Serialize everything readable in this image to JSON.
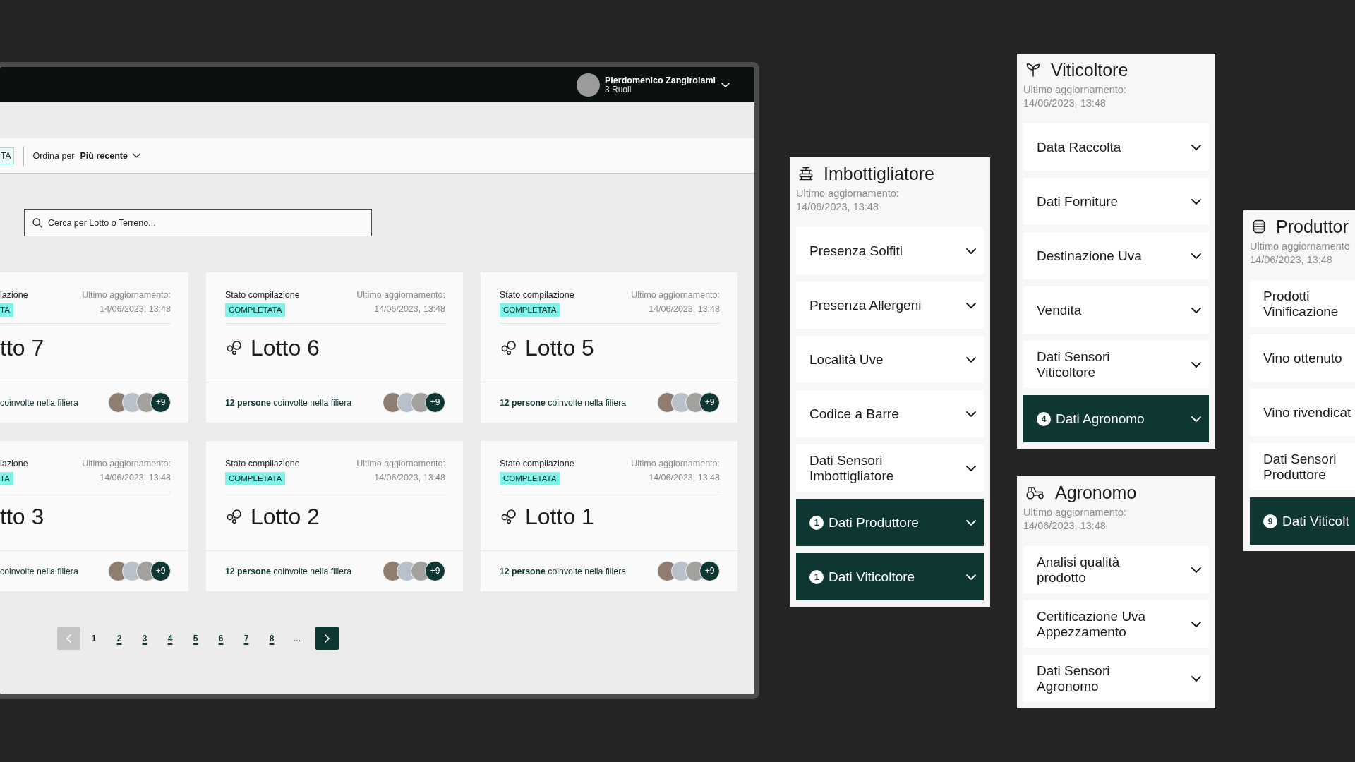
{
  "app_window": {
    "header": {
      "user_name": "Pierdomenico Zangirolami",
      "user_roles": "3 Ruoli"
    },
    "filter_bar": {
      "status_filter": "TA",
      "sort_label": "Ordina per",
      "sort_value": "Più recente"
    },
    "search": {
      "placeholder": "Cerca per Lotto o Terreno..."
    },
    "cards": [
      {
        "clipped": true,
        "status_label": "lazione",
        "status": "TA",
        "updated_label": "Ultimo aggiornamento:",
        "updated_at": "14/06/2023, 13:48",
        "title": "tto 7",
        "people": "coinvolte nella filiera",
        "more_people": "+9"
      },
      {
        "clipped": false,
        "status_label": "Stato compilazione",
        "status": "COMPLETATA",
        "updated_label": "Ultimo aggiornamento:",
        "updated_at": "14/06/2023, 13:48",
        "title": "Lotto 6",
        "people": "**12 persone** coinvolte nella filiera",
        "more_people": "+9"
      },
      {
        "clipped": false,
        "status_label": "Stato compilazione",
        "status": "COMPLETATA",
        "updated_label": "Ultimo aggiornamento:",
        "updated_at": "14/06/2023, 13:48",
        "title": "Lotto 5",
        "people": "**12 persone** coinvolte nella filiera",
        "more_people": "+9"
      },
      {
        "clipped": true,
        "status_label": "lazione",
        "status": "TA",
        "updated_label": "Ultimo aggiornamento:",
        "updated_at": "14/06/2023, 13:48",
        "title": "tto 3",
        "people": "coinvolte nella filiera",
        "more_people": "+9"
      },
      {
        "clipped": false,
        "status_label": "Stato compilazione",
        "status": "COMPLETATA",
        "updated_label": "Ultimo aggiornamento:",
        "updated_at": "14/06/2023, 13:48",
        "title": "Lotto 2",
        "people": "**12 persone** coinvolte nella filiera",
        "more_people": "+9"
      },
      {
        "clipped": false,
        "status_label": "Stato compilazione",
        "status": "COMPLETATA",
        "updated_label": "Ultimo aggiornamento:",
        "updated_at": "14/06/2023, 13:48",
        "title": "Lotto 1",
        "people": "**12 persone** coinvolte nella filiera",
        "more_people": "+9"
      }
    ],
    "pagination": {
      "previous": {
        "disabled": true
      },
      "pages": [
        {
          "label": "1",
          "selected": true
        },
        {
          "label": "2",
          "selected": false
        },
        {
          "label": "3",
          "selected": false
        },
        {
          "label": "4",
          "selected": false
        },
        {
          "label": "5",
          "selected": false
        },
        {
          "label": "6",
          "selected": false
        },
        {
          "label": "7",
          "selected": false
        },
        {
          "label": "8",
          "selected": false
        }
      ],
      "ellipsis": "...",
      "next": {
        "disabled": false
      }
    }
  },
  "panels": [
    {
      "kind": "bottler",
      "clipped": false,
      "title": "Imbottigliatore",
      "updated_label": "Ultimo aggiornamento:",
      "updated_at": "14/06/2023, 13:48",
      "items": [
        {
          "kind": "field",
          "label": "Presenza Solfiti"
        },
        {
          "kind": "field",
          "label": "Presenza Allergeni"
        },
        {
          "kind": "field",
          "label": "Località Uve"
        },
        {
          "kind": "field",
          "label": "Codice a Barre"
        },
        {
          "kind": "field",
          "label": "Dati Sensori Imbottigliatore"
        },
        {
          "kind": "linked",
          "count": "1",
          "label": "Dati Produttore"
        },
        {
          "kind": "linked",
          "count": "1",
          "label": "Dati Viticoltore"
        }
      ]
    },
    {
      "kind": "grower",
      "clipped": false,
      "title": "Viticoltore",
      "updated_label": "Ultimo aggiornamento:",
      "updated_at": "14/06/2023, 13:48",
      "items": [
        {
          "kind": "field",
          "label": "Data Raccolta"
        },
        {
          "kind": "field",
          "label": "Dati Forniture"
        },
        {
          "kind": "field",
          "label": "Destinazione Uva"
        },
        {
          "kind": "field",
          "label": "Vendita"
        },
        {
          "kind": "field",
          "label": "Dati Sensori Viticoltore"
        },
        {
          "kind": "linked",
          "count": "4",
          "label": "Dati Agronomo"
        }
      ]
    },
    {
      "kind": "agronomist",
      "clipped": false,
      "title": "Agronomo",
      "updated_label": "Ultimo aggiornamento:",
      "updated_at": "14/06/2023, 13:48",
      "items": [
        {
          "kind": "field",
          "label": "Analisi qualità prodotto"
        },
        {
          "kind": "field",
          "label": "Certificazione Uva Appezzamento"
        },
        {
          "kind": "field",
          "label": "Dati Sensori Agronomo"
        }
      ]
    },
    {
      "kind": "producer",
      "clipped": true,
      "title": "Produttor",
      "updated_label": "Ultimo aggiornamento",
      "updated_at": "14/06/2023, 13:48",
      "items": [
        {
          "kind": "field",
          "label": "Prodotti Vinificazione"
        },
        {
          "kind": "field",
          "label": "Vino ottenuto"
        },
        {
          "kind": "field",
          "label": "Vino rivendicat"
        },
        {
          "kind": "field",
          "label": "Dati Sensori Produttore"
        },
        {
          "kind": "linked",
          "count": "9",
          "label": "Dati Viticolt"
        }
      ]
    }
  ]
}
